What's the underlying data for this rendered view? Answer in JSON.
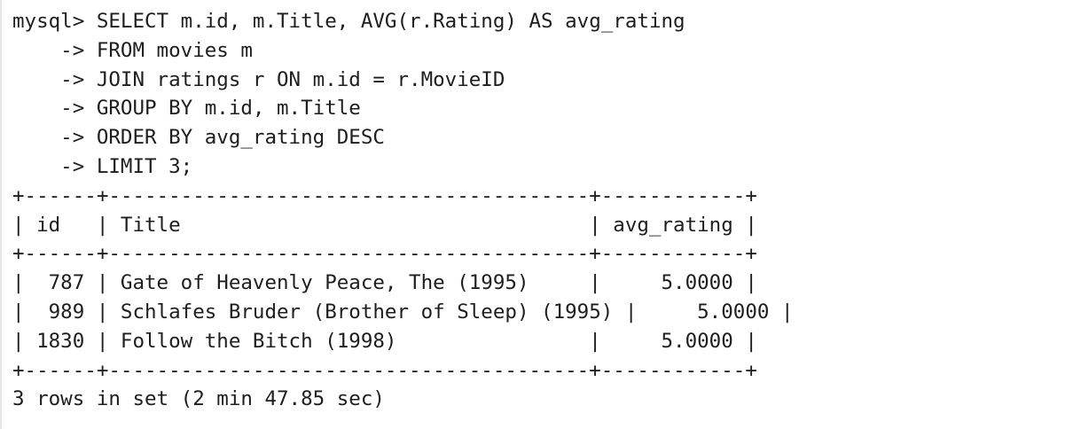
{
  "terminal": {
    "query_lines": [
      "mysql> SELECT m.id, m.Title, AVG(r.Rating) AS avg_rating",
      "    -> FROM movies m",
      "    -> JOIN ratings r ON m.id = r.MovieID",
      "    -> GROUP BY m.id, m.Title",
      "    -> ORDER BY avg_rating DESC",
      "    -> LIMIT 3;"
    ],
    "table": {
      "separator": "+------+----------------------------------------+------------+",
      "header": "| id   | Title                                  | avg_rating |",
      "columns": [
        "id",
        "Title",
        "avg_rating"
      ],
      "rows": [
        {
          "id": "787",
          "title": "Gate of Heavenly Peace, The (1995)",
          "avg_rating": "5.0000",
          "line": "|  787 | Gate of Heavenly Peace, The (1995)     |     5.0000 |"
        },
        {
          "id": "989",
          "title": "Schlafes Bruder (Brother of Sleep) (1995)",
          "avg_rating": "5.0000",
          "line": "|  989 | Schlafes Bruder (Brother of Sleep) (1995) |     5.0000 |"
        },
        {
          "id": "1830",
          "title": "Follow the Bitch (1998)",
          "avg_rating": "5.0000",
          "line": "| 1830 | Follow the Bitch (1998)                |     5.0000 |"
        }
      ]
    },
    "result_status": "3 rows in set (2 min 47.85 sec)"
  }
}
